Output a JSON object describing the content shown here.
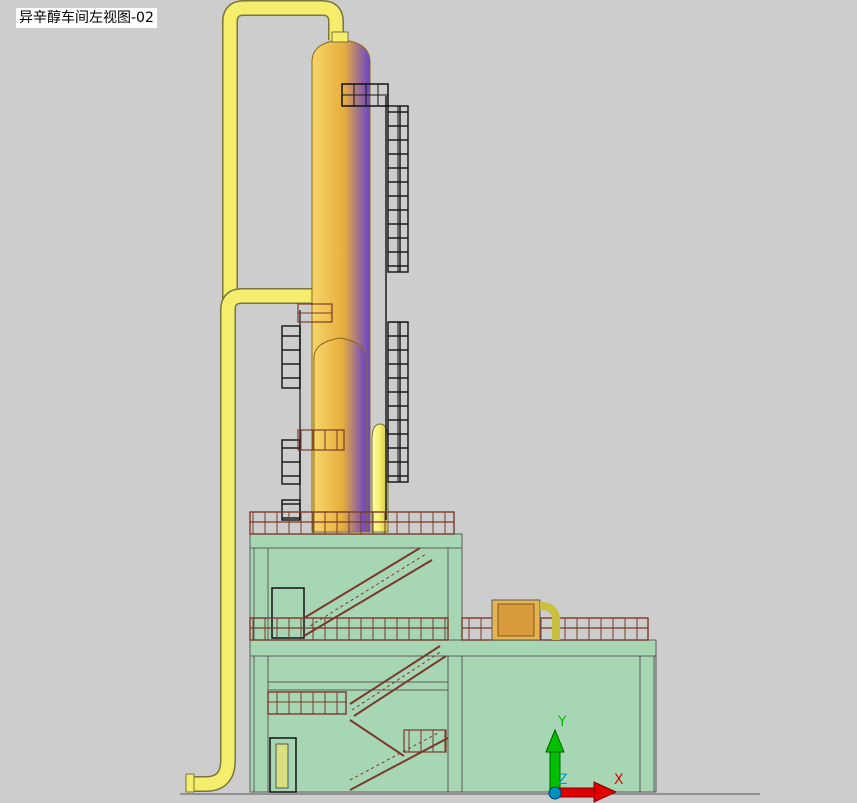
{
  "viewport": {
    "title": "异辛醇车间左视图-02",
    "background": "#cdcdcd"
  },
  "colors": {
    "vessel_light": "#f7d56a",
    "vessel_mid": "#e8ae3c",
    "vessel_shade": "#6a44c8",
    "pipe": "#f4ee6c",
    "pipe_stroke": "#7a7440",
    "building_fill": "#a7d6b5",
    "building_stroke": "#5c5c5c",
    "railing": "#7a3a2a",
    "ladder": "#111111",
    "ucs_y": "#00c000",
    "ucs_x": "#e00000",
    "ucs_z": "#00a0c0"
  },
  "ucs_icon": {
    "x_label": "X",
    "y_label": "Y",
    "z_label": "Z"
  }
}
